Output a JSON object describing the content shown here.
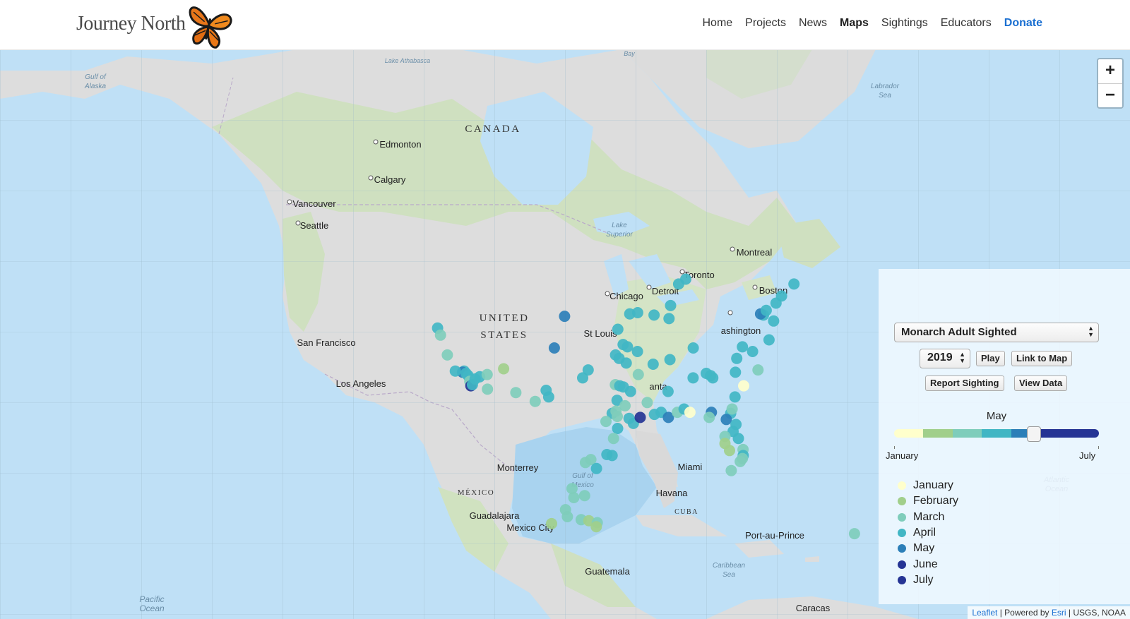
{
  "header": {
    "logo_text": "Journey North",
    "nav": [
      {
        "label": "Home",
        "name": "nav-home"
      },
      {
        "label": "Projects",
        "name": "nav-projects"
      },
      {
        "label": "News",
        "name": "nav-news"
      },
      {
        "label": "Maps",
        "name": "nav-maps",
        "active": true
      },
      {
        "label": "Sightings",
        "name": "nav-sightings"
      },
      {
        "label": "Educators",
        "name": "nav-educators"
      },
      {
        "label": "Donate",
        "name": "nav-donate"
      }
    ]
  },
  "map": {
    "labels": {
      "gulf_alaska": "Gulf of Alaska",
      "athabasca": "Lake Athabasca",
      "canada": "CANADA",
      "labrador": "Labrador Sea",
      "edmonton": "Edmonton",
      "calgary": "Calgary",
      "vancouver": "Vancouver",
      "seattle": "Seattle",
      "superior": "Lake Superior",
      "montreal": "Montreal",
      "toronto": "Toronto",
      "detroit": "Detroit",
      "chicago": "Chicago",
      "boston": "Boston",
      "united": "UNITED",
      "states": "STATES",
      "stlouis": "St Louis",
      "washington": "ashington",
      "sanfrancisco": "San Francisco",
      "losangeles": "Los Angeles",
      "atlanta": "anta",
      "monterrey": "Monterrey",
      "gulf_mexico": "Gulf of Mexico",
      "miami": "Miami",
      "mexico": "MÉXICO",
      "havana": "Havana",
      "cuba": "CUBA",
      "guadalajara": "Guadalajara",
      "mexicocity": "Mexico City",
      "portauprince": "Port-au-Prince",
      "atlantic": "Atlantic Ocean",
      "caribbean": "Caribbean Sea",
      "guatemala": "Guatemala",
      "pacific": "Pacific Ocean",
      "caracas": "Caracas",
      "bay": "Bay"
    },
    "zoom_in": "+",
    "zoom_out": "−",
    "markers": [
      {
        "lat": 37.8,
        "lon": -122.4,
        "m": 4
      },
      {
        "lat": 37.2,
        "lon": -121.9,
        "m": 3
      },
      {
        "lat": 35.5,
        "lon": -120.7,
        "m": 3
      },
      {
        "lat": 34.1,
        "lon": -118.2,
        "m": 4
      },
      {
        "lat": 34.0,
        "lon": -118.4,
        "m": 5
      },
      {
        "lat": 33.9,
        "lon": -117.9,
        "m": 4
      },
      {
        "lat": 33.7,
        "lon": -117.6,
        "m": 4
      },
      {
        "lat": 33.2,
        "lon": -117.3,
        "m": 3
      },
      {
        "lat": 32.8,
        "lon": -117.1,
        "m": 6
      },
      {
        "lat": 33.4,
        "lon": -116.6,
        "m": 4
      },
      {
        "lat": 33.6,
        "lon": -116.0,
        "m": 4
      },
      {
        "lat": 34.1,
        "lon": -119.4,
        "m": 4
      },
      {
        "lat": 32.9,
        "lon": -116.9,
        "m": 4
      },
      {
        "lat": 33.8,
        "lon": -115.0,
        "m": 3
      },
      {
        "lat": 32.5,
        "lon": -114.8,
        "m": 3
      },
      {
        "lat": 34.3,
        "lon": -112.8,
        "m": 2
      },
      {
        "lat": 32.2,
        "lon": -110.9,
        "m": 3
      },
      {
        "lat": 31.4,
        "lon": -108.2,
        "m": 3
      },
      {
        "lat": 32.4,
        "lon": -106.8,
        "m": 4
      },
      {
        "lat": 31.8,
        "lon": -106.4,
        "m": 4
      },
      {
        "lat": 36.1,
        "lon": -106.0,
        "m": 5
      },
      {
        "lat": 38.8,
        "lon": -104.8,
        "m": 5
      },
      {
        "lat": 33.5,
        "lon": -101.9,
        "m": 4
      },
      {
        "lat": 34.2,
        "lon": -101.2,
        "m": 4
      },
      {
        "lat": 32.9,
        "lon": -97.4,
        "m": 3
      },
      {
        "lat": 32.8,
        "lon": -96.8,
        "m": 4
      },
      {
        "lat": 32.7,
        "lon": -96.3,
        "m": 4
      },
      {
        "lat": 32.3,
        "lon": -95.3,
        "m": 4
      },
      {
        "lat": 31.5,
        "lon": -97.1,
        "m": 4
      },
      {
        "lat": 30.3,
        "lon": -97.7,
        "m": 4
      },
      {
        "lat": 30.5,
        "lon": -97.2,
        "m": 3
      },
      {
        "lat": 29.8,
        "lon": -95.4,
        "m": 4
      },
      {
        "lat": 29.5,
        "lon": -98.5,
        "m": 3
      },
      {
        "lat": 29.3,
        "lon": -94.8,
        "m": 4
      },
      {
        "lat": 29.9,
        "lon": -93.9,
        "m": 6
      },
      {
        "lat": 30.2,
        "lon": -92.0,
        "m": 4
      },
      {
        "lat": 30.4,
        "lon": -91.1,
        "m": 4
      },
      {
        "lat": 29.9,
        "lon": -90.1,
        "m": 5
      },
      {
        "lat": 30.4,
        "lon": -88.9,
        "m": 3
      },
      {
        "lat": 30.7,
        "lon": -88.0,
        "m": 4
      },
      {
        "lat": 30.4,
        "lon": -87.2,
        "m": 1
      },
      {
        "lat": 30.4,
        "lon": -84.3,
        "m": 5
      },
      {
        "lat": 29.9,
        "lon": -84.6,
        "m": 3
      },
      {
        "lat": 30.3,
        "lon": -81.7,
        "m": 4
      },
      {
        "lat": 29.7,
        "lon": -82.3,
        "m": 5
      },
      {
        "lat": 29.2,
        "lon": -81.0,
        "m": 4
      },
      {
        "lat": 28.5,
        "lon": -81.4,
        "m": 4
      },
      {
        "lat": 28.0,
        "lon": -82.5,
        "m": 3
      },
      {
        "lat": 27.3,
        "lon": -82.5,
        "m": 2
      },
      {
        "lat": 27.8,
        "lon": -80.7,
        "m": 4
      },
      {
        "lat": 26.7,
        "lon": -80.1,
        "m": 3
      },
      {
        "lat": 26.1,
        "lon": -80.1,
        "m": 4
      },
      {
        "lat": 25.8,
        "lon": -80.2,
        "m": 3
      },
      {
        "lat": 25.5,
        "lon": -80.5,
        "m": 3
      },
      {
        "lat": 26.6,
        "lon": -81.9,
        "m": 2
      },
      {
        "lat": 24.6,
        "lon": -81.7,
        "m": 3
      },
      {
        "lat": 33.7,
        "lon": -84.4,
        "m": 4
      },
      {
        "lat": 33.5,
        "lon": -84.1,
        "m": 4
      },
      {
        "lat": 33.9,
        "lon": -85.0,
        "m": 4
      },
      {
        "lat": 34.0,
        "lon": -81.0,
        "m": 4
      },
      {
        "lat": 32.8,
        "lon": -79.9,
        "m": 1
      },
      {
        "lat": 34.2,
        "lon": -77.9,
        "m": 3
      },
      {
        "lat": 35.8,
        "lon": -78.6,
        "m": 4
      },
      {
        "lat": 35.2,
        "lon": -80.8,
        "m": 4
      },
      {
        "lat": 36.2,
        "lon": -80.0,
        "m": 4
      },
      {
        "lat": 36.8,
        "lon": -76.3,
        "m": 4
      },
      {
        "lat": 38.9,
        "lon": -77.0,
        "m": 4
      },
      {
        "lat": 39.0,
        "lon": -77.4,
        "m": 5
      },
      {
        "lat": 39.3,
        "lon": -76.6,
        "m": 4
      },
      {
        "lat": 39.9,
        "lon": -75.2,
        "m": 4
      },
      {
        "lat": 38.4,
        "lon": -75.6,
        "m": 4
      },
      {
        "lat": 41.5,
        "lon": -72.6,
        "m": 4
      },
      {
        "lat": 41.9,
        "lon": -87.9,
        "m": 4
      },
      {
        "lat": 41.5,
        "lon": -88.9,
        "m": 4
      },
      {
        "lat": 39.7,
        "lon": -90.0,
        "m": 4
      },
      {
        "lat": 38.6,
        "lon": -90.2,
        "m": 4
      },
      {
        "lat": 38.9,
        "lon": -92.3,
        "m": 4
      },
      {
        "lat": 39.1,
        "lon": -94.6,
        "m": 4
      },
      {
        "lat": 39.0,
        "lon": -95.7,
        "m": 4
      },
      {
        "lat": 37.7,
        "lon": -97.3,
        "m": 4
      },
      {
        "lat": 36.4,
        "lon": -96.5,
        "m": 4
      },
      {
        "lat": 36.2,
        "lon": -95.9,
        "m": 4
      },
      {
        "lat": 35.5,
        "lon": -97.5,
        "m": 4
      },
      {
        "lat": 35.2,
        "lon": -97.0,
        "m": 4
      },
      {
        "lat": 35.8,
        "lon": -94.5,
        "m": 4
      },
      {
        "lat": 34.7,
        "lon": -92.3,
        "m": 4
      },
      {
        "lat": 35.1,
        "lon": -90.0,
        "m": 4
      },
      {
        "lat": 32.3,
        "lon": -90.2,
        "m": 4
      },
      {
        "lat": 33.5,
        "lon": -86.8,
        "m": 4
      },
      {
        "lat": 36.1,
        "lon": -86.8,
        "m": 4
      },
      {
        "lat": 34.8,
        "lon": -96.0,
        "m": 4
      },
      {
        "lat": 33.8,
        "lon": -94.3,
        "m": 3
      },
      {
        "lat": 31.3,
        "lon": -93.0,
        "m": 3
      },
      {
        "lat": 31.0,
        "lon": -96.0,
        "m": 3
      },
      {
        "lat": 30.0,
        "lon": -97.0,
        "m": 3
      },
      {
        "lat": 28.8,
        "lon": -96.9,
        "m": 4
      },
      {
        "lat": 27.8,
        "lon": -97.4,
        "m": 3
      },
      {
        "lat": 26.2,
        "lon": -98.2,
        "m": 4
      },
      {
        "lat": 26.1,
        "lon": -97.5,
        "m": 4
      },
      {
        "lat": 25.7,
        "lon": -100.3,
        "m": 3
      },
      {
        "lat": 25.4,
        "lon": -101.0,
        "m": 3
      },
      {
        "lat": 24.8,
        "lon": -99.5,
        "m": 4
      },
      {
        "lat": 22.1,
        "lon": -100.9,
        "m": 3
      },
      {
        "lat": 22.8,
        "lon": -102.6,
        "m": 3
      },
      {
        "lat": 21.9,
        "lon": -102.3,
        "m": 3
      },
      {
        "lat": 20.7,
        "lon": -103.3,
        "m": 3
      },
      {
        "lat": 20.0,
        "lon": -103.0,
        "m": 3
      },
      {
        "lat": 19.7,
        "lon": -101.2,
        "m": 3
      },
      {
        "lat": 19.6,
        "lon": -100.2,
        "m": 2
      },
      {
        "lat": 19.4,
        "lon": -99.1,
        "m": 3
      },
      {
        "lat": 19.0,
        "lon": -99.2,
        "m": 2
      },
      {
        "lat": 19.3,
        "lon": -105.0,
        "m": 2
      },
      {
        "lat": 18.3,
        "lon": -65.9,
        "m": 3
      },
      {
        "lat": 40.5,
        "lon": -74.4,
        "m": 4
      },
      {
        "lat": 30.7,
        "lon": -81.5,
        "m": 3
      },
      {
        "lat": 31.8,
        "lon": -81.1,
        "m": 4
      }
    ]
  },
  "panel": {
    "dataset": "Monarch Adult Sighted",
    "year": "2019",
    "play": "Play",
    "link": "Link to Map",
    "report": "Report Sighting",
    "view": "View Data",
    "current_month": "May",
    "current_fraction": 0.68,
    "range_start": "January",
    "range_end": "July",
    "legend": [
      {
        "label": "January",
        "color": "#ffffcc"
      },
      {
        "label": "February",
        "color": "#a1cf8b"
      },
      {
        "label": "March",
        "color": "#7fcdbb"
      },
      {
        "label": "April",
        "color": "#41b6c4"
      },
      {
        "label": "May",
        "color": "#2c7fb8"
      },
      {
        "label": "June",
        "color": "#253494"
      },
      {
        "label": "July",
        "color": "#253494"
      }
    ]
  },
  "attribution": {
    "leaflet": "Leaflet",
    "sep1": " | Powered by ",
    "esri": "Esri",
    "sep2": " | USGS, NOAA"
  }
}
